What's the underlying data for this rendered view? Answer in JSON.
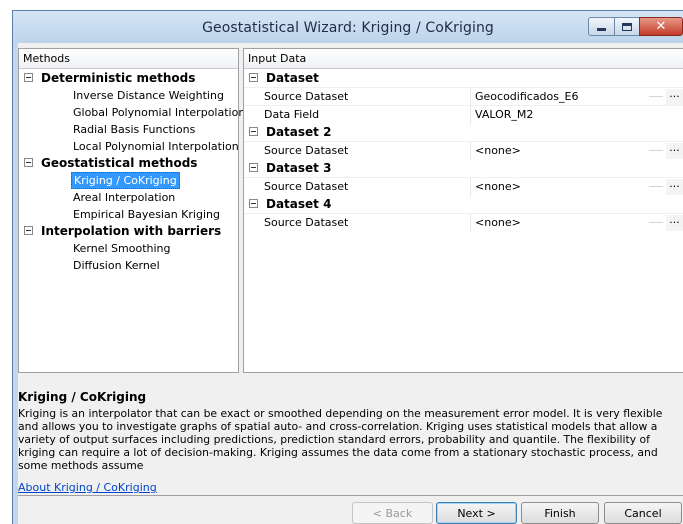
{
  "window": {
    "title": "Geostatistical Wizard: Kriging / CoKriging",
    "close_glyph": "✕"
  },
  "methods": {
    "header": "Methods",
    "groups": [
      {
        "label": "Deterministic methods",
        "items": [
          "Inverse Distance Weighting",
          "Global Polynomial Interpolation",
          "Radial Basis Functions",
          "Local Polynomial Interpolation"
        ]
      },
      {
        "label": "Geostatistical methods",
        "items": [
          "Kriging / CoKriging",
          "Areal Interpolation",
          "Empirical Bayesian Kriging"
        ]
      },
      {
        "label": "Interpolation with barriers",
        "items": [
          "Kernel Smoothing",
          "Diffusion Kernel"
        ]
      }
    ],
    "selected": "Kriging / CoKriging"
  },
  "input_data": {
    "header": "Input Data",
    "datasets": [
      {
        "label": "Dataset",
        "rows": [
          {
            "name": "Source Dataset",
            "value": "Geocodificados_E6",
            "button": "..."
          },
          {
            "name": "Data Field",
            "value": "VALOR_M2",
            "button": ""
          }
        ]
      },
      {
        "label": "Dataset 2",
        "rows": [
          {
            "name": "Source Dataset",
            "value": "<none>",
            "button": "..."
          }
        ]
      },
      {
        "label": "Dataset 3",
        "rows": [
          {
            "name": "Source Dataset",
            "value": "<none>",
            "button": "..."
          }
        ]
      },
      {
        "label": "Dataset 4",
        "rows": [
          {
            "name": "Source Dataset",
            "value": "<none>",
            "button": "..."
          }
        ]
      }
    ]
  },
  "description": {
    "title": "Kriging / CoKriging",
    "text": "Kriging is an interpolator that can be exact or smoothed depending on the measurement error model. It is very flexible and allows you to investigate graphs of spatial auto- and cross-correlation. Kriging uses statistical models that allow a variety of output surfaces including predictions, prediction standard errors, probability and quantile. The flexibility of kriging can require a lot of decision-making. Kriging assumes the data come from a stationary stochastic process, and some methods assume",
    "link": "About Kriging / CoKriging"
  },
  "buttons": {
    "back": "< Back",
    "next": "Next >",
    "finish": "Finish",
    "cancel": "Cancel"
  }
}
